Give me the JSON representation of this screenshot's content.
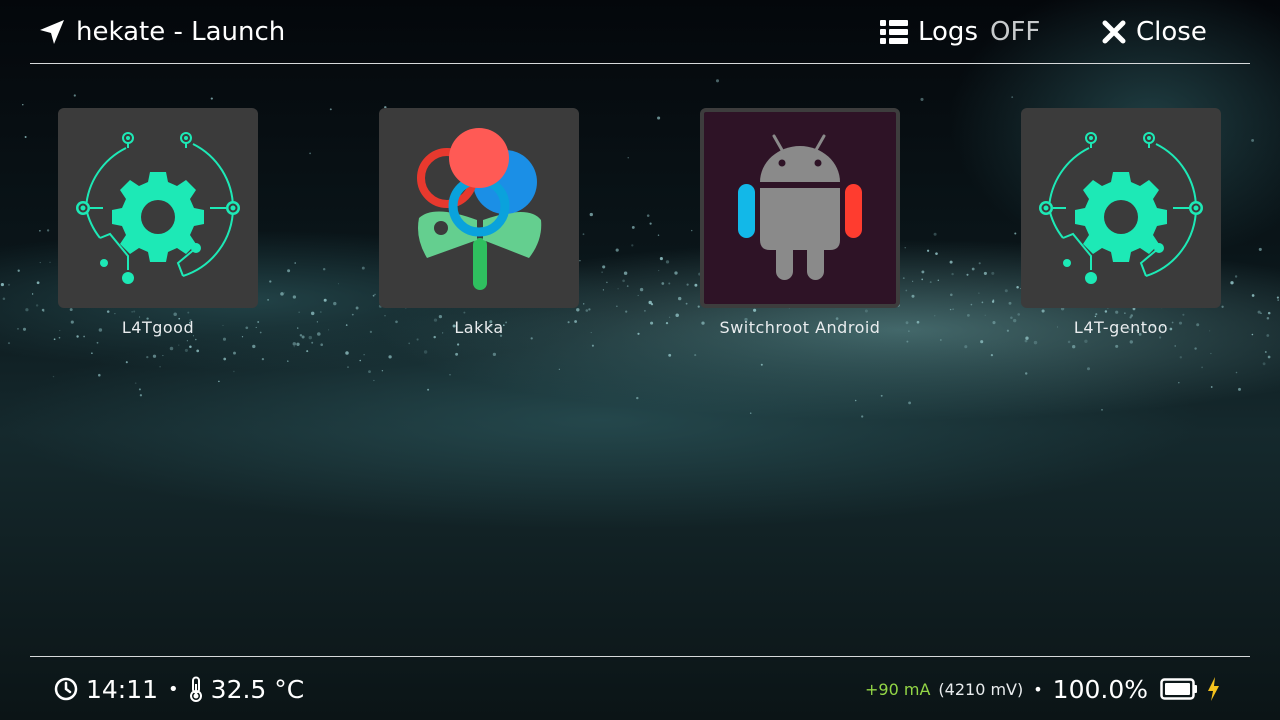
{
  "header": {
    "title": "hekate - Launch",
    "logs_label": "Logs",
    "logs_state": "OFF",
    "close_label": "Close"
  },
  "entries": [
    {
      "label": "L4Tgood",
      "icon": "linux-gear-circuit-icon"
    },
    {
      "label": "Lakka",
      "icon": "lakka-flower-icon"
    },
    {
      "label": "Switchroot Android",
      "icon": "android-joycon-icon"
    },
    {
      "label": "L4T-gentoo",
      "icon": "linux-gear-circuit-icon"
    }
  ],
  "status": {
    "time": "14:11",
    "temperature": "32.5 °C",
    "current": "+90 mA",
    "voltage": "(4210 mV)",
    "battery_percent": "100.0%",
    "battery_level": 1.0,
    "charging": true
  },
  "colors": {
    "accent_teal": "#1de9b6",
    "current_green": "#93d646",
    "charging_yellow": "#f4c21d",
    "tile_bg": "#3b3b3b",
    "android_tile_bg": "#2e1326"
  },
  "separator": "•"
}
